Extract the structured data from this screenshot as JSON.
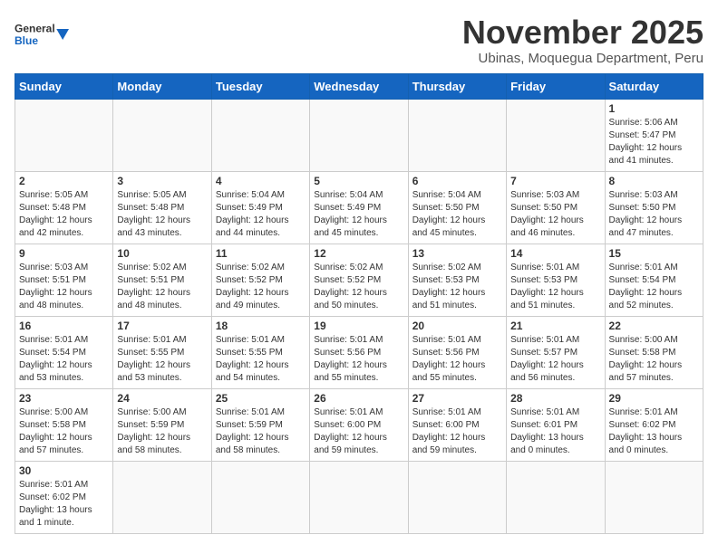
{
  "header": {
    "logo_general": "General",
    "logo_blue": "Blue",
    "month": "November 2025",
    "location": "Ubinas, Moquegua Department, Peru"
  },
  "weekdays": [
    "Sunday",
    "Monday",
    "Tuesday",
    "Wednesday",
    "Thursday",
    "Friday",
    "Saturday"
  ],
  "weeks": [
    [
      {
        "day": "",
        "info": ""
      },
      {
        "day": "",
        "info": ""
      },
      {
        "day": "",
        "info": ""
      },
      {
        "day": "",
        "info": ""
      },
      {
        "day": "",
        "info": ""
      },
      {
        "day": "",
        "info": ""
      },
      {
        "day": "1",
        "info": "Sunrise: 5:06 AM\nSunset: 5:47 PM\nDaylight: 12 hours and 41 minutes."
      }
    ],
    [
      {
        "day": "2",
        "info": "Sunrise: 5:05 AM\nSunset: 5:48 PM\nDaylight: 12 hours and 42 minutes."
      },
      {
        "day": "3",
        "info": "Sunrise: 5:05 AM\nSunset: 5:48 PM\nDaylight: 12 hours and 43 minutes."
      },
      {
        "day": "4",
        "info": "Sunrise: 5:04 AM\nSunset: 5:49 PM\nDaylight: 12 hours and 44 minutes."
      },
      {
        "day": "5",
        "info": "Sunrise: 5:04 AM\nSunset: 5:49 PM\nDaylight: 12 hours and 45 minutes."
      },
      {
        "day": "6",
        "info": "Sunrise: 5:04 AM\nSunset: 5:50 PM\nDaylight: 12 hours and 45 minutes."
      },
      {
        "day": "7",
        "info": "Sunrise: 5:03 AM\nSunset: 5:50 PM\nDaylight: 12 hours and 46 minutes."
      },
      {
        "day": "8",
        "info": "Sunrise: 5:03 AM\nSunset: 5:50 PM\nDaylight: 12 hours and 47 minutes."
      }
    ],
    [
      {
        "day": "9",
        "info": "Sunrise: 5:03 AM\nSunset: 5:51 PM\nDaylight: 12 hours and 48 minutes."
      },
      {
        "day": "10",
        "info": "Sunrise: 5:02 AM\nSunset: 5:51 PM\nDaylight: 12 hours and 48 minutes."
      },
      {
        "day": "11",
        "info": "Sunrise: 5:02 AM\nSunset: 5:52 PM\nDaylight: 12 hours and 49 minutes."
      },
      {
        "day": "12",
        "info": "Sunrise: 5:02 AM\nSunset: 5:52 PM\nDaylight: 12 hours and 50 minutes."
      },
      {
        "day": "13",
        "info": "Sunrise: 5:02 AM\nSunset: 5:53 PM\nDaylight: 12 hours and 51 minutes."
      },
      {
        "day": "14",
        "info": "Sunrise: 5:01 AM\nSunset: 5:53 PM\nDaylight: 12 hours and 51 minutes."
      },
      {
        "day": "15",
        "info": "Sunrise: 5:01 AM\nSunset: 5:54 PM\nDaylight: 12 hours and 52 minutes."
      }
    ],
    [
      {
        "day": "16",
        "info": "Sunrise: 5:01 AM\nSunset: 5:54 PM\nDaylight: 12 hours and 53 minutes."
      },
      {
        "day": "17",
        "info": "Sunrise: 5:01 AM\nSunset: 5:55 PM\nDaylight: 12 hours and 53 minutes."
      },
      {
        "day": "18",
        "info": "Sunrise: 5:01 AM\nSunset: 5:55 PM\nDaylight: 12 hours and 54 minutes."
      },
      {
        "day": "19",
        "info": "Sunrise: 5:01 AM\nSunset: 5:56 PM\nDaylight: 12 hours and 55 minutes."
      },
      {
        "day": "20",
        "info": "Sunrise: 5:01 AM\nSunset: 5:56 PM\nDaylight: 12 hours and 55 minutes."
      },
      {
        "day": "21",
        "info": "Sunrise: 5:01 AM\nSunset: 5:57 PM\nDaylight: 12 hours and 56 minutes."
      },
      {
        "day": "22",
        "info": "Sunrise: 5:00 AM\nSunset: 5:58 PM\nDaylight: 12 hours and 57 minutes."
      }
    ],
    [
      {
        "day": "23",
        "info": "Sunrise: 5:00 AM\nSunset: 5:58 PM\nDaylight: 12 hours and 57 minutes."
      },
      {
        "day": "24",
        "info": "Sunrise: 5:00 AM\nSunset: 5:59 PM\nDaylight: 12 hours and 58 minutes."
      },
      {
        "day": "25",
        "info": "Sunrise: 5:01 AM\nSunset: 5:59 PM\nDaylight: 12 hours and 58 minutes."
      },
      {
        "day": "26",
        "info": "Sunrise: 5:01 AM\nSunset: 6:00 PM\nDaylight: 12 hours and 59 minutes."
      },
      {
        "day": "27",
        "info": "Sunrise: 5:01 AM\nSunset: 6:00 PM\nDaylight: 12 hours and 59 minutes."
      },
      {
        "day": "28",
        "info": "Sunrise: 5:01 AM\nSunset: 6:01 PM\nDaylight: 13 hours and 0 minutes."
      },
      {
        "day": "29",
        "info": "Sunrise: 5:01 AM\nSunset: 6:02 PM\nDaylight: 13 hours and 0 minutes."
      }
    ],
    [
      {
        "day": "30",
        "info": "Sunrise: 5:01 AM\nSunset: 6:02 PM\nDaylight: 13 hours and 1 minute."
      },
      {
        "day": "",
        "info": ""
      },
      {
        "day": "",
        "info": ""
      },
      {
        "day": "",
        "info": ""
      },
      {
        "day": "",
        "info": ""
      },
      {
        "day": "",
        "info": ""
      },
      {
        "day": "",
        "info": ""
      }
    ]
  ]
}
